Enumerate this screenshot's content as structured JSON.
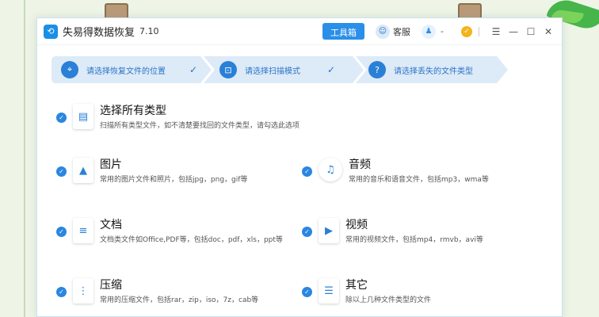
{
  "app": {
    "title": "失易得数据恢复",
    "version": "7.10",
    "toolbox_label": "工具箱",
    "service_label": "客服",
    "qq_label": "-"
  },
  "steps": [
    {
      "label": "请选择恢复文件的位置",
      "icon": "location-pin-icon",
      "done": true
    },
    {
      "label": "请选择扫描模式",
      "icon": "scan-icon",
      "done": true
    },
    {
      "label": "请选择丢失的文件类型",
      "icon": "question-icon",
      "done": false
    }
  ],
  "options": {
    "all": {
      "title": "选择所有类型",
      "desc": "扫描所有类型文件，如不清楚要找回的文件类型，请勾选此选项",
      "icon": "all-files-icon"
    },
    "image": {
      "title": "图片",
      "desc": "常用的图片文件和照片，包括jpg，png，gif等",
      "icon": "image-icon"
    },
    "audio": {
      "title": "音频",
      "desc": "常用的音乐和语音文件，包括mp3，wma等",
      "icon": "music-note-icon"
    },
    "doc": {
      "title": "文档",
      "desc": "文档类文件如Office,PDF等，包括doc，pdf，xls，ppt等",
      "icon": "document-icon"
    },
    "video": {
      "title": "视频",
      "desc": "常用的视频文件，包括mp4，rmvb，avi等",
      "icon": "video-icon"
    },
    "zip": {
      "title": "压缩",
      "desc": "常用的压缩文件，包括rar，zip，iso，7z，cab等",
      "icon": "zip-icon"
    },
    "other": {
      "title": "其它",
      "desc": "除以上几种文件类型的文件",
      "icon": "list-icon"
    }
  },
  "colors": {
    "accent": "#2a86e0",
    "step_bg": "#ddeaf7"
  }
}
